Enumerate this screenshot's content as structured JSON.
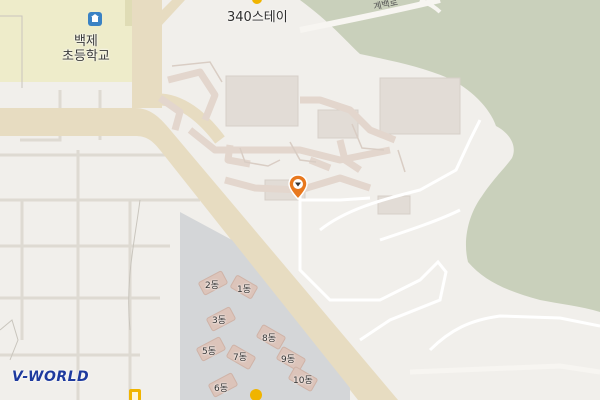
{
  "map": {
    "provider_logo": "V-WORLD",
    "pois": {
      "school_name_line1": "백제",
      "school_name_line2": "초등학교",
      "stay_name": "340스테이",
      "road_name": "계백로"
    },
    "apartment_buildings": [
      "1동",
      "2동",
      "3동",
      "5동",
      "6동",
      "7동",
      "8동",
      "9동",
      "10동"
    ],
    "colors": {
      "background": "#f1efeb",
      "forest": "#c9d0bb",
      "main_road": "#e7dcc1",
      "school_grounds": "#eeecca",
      "parking_lot": "#d4d6d8",
      "building": "#dcc4ba",
      "marker": "#e8781e",
      "poi_icon_blue": "#3a82c4",
      "poi_icon_yellow": "#f0b400"
    },
    "icons": {
      "school": "school-icon",
      "stay": "stay-icon",
      "marker": "location-marker-icon"
    }
  }
}
